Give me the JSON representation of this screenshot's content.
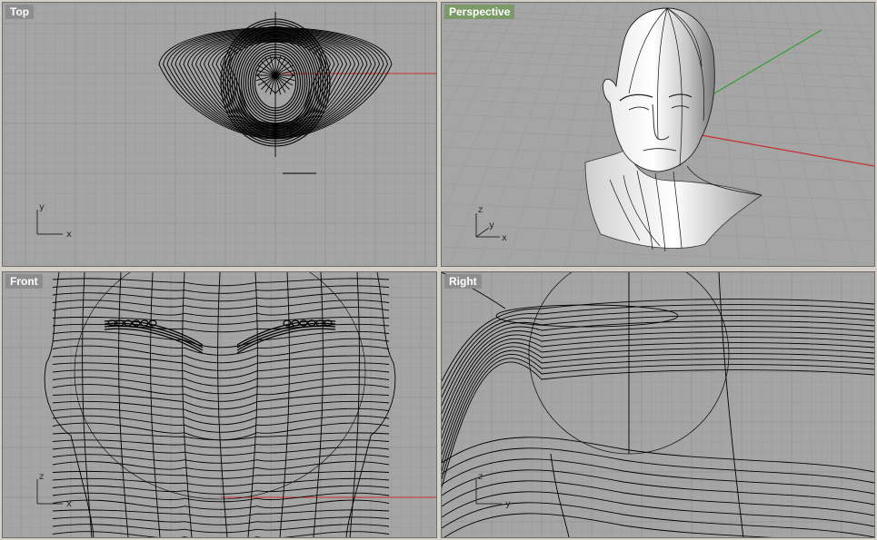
{
  "viewports": {
    "top": {
      "label": "Top",
      "axes": {
        "horizontal": "x",
        "vertical": "y"
      }
    },
    "perspective": {
      "label": "Perspective",
      "axes": {
        "depth": "z",
        "horizontal": "y",
        "side": "x"
      }
    },
    "front": {
      "label": "Front",
      "axes": {
        "horizontal": "x",
        "vertical": "z"
      }
    },
    "right": {
      "label": "Right",
      "axes": {
        "horizontal": "y",
        "vertical": "z"
      }
    }
  },
  "colors": {
    "viewport_background": "#a5a5a5",
    "grid_line": "#9a9a9a",
    "grid_major": "#8c8c8c",
    "x_axis": "#c83030",
    "y_axis": "#30a030",
    "curve": "#000000",
    "active_label_background": "#7a9a68",
    "inactive_label_background": "#8d8d8d"
  },
  "icons": [
    "axis-triad-icon"
  ]
}
